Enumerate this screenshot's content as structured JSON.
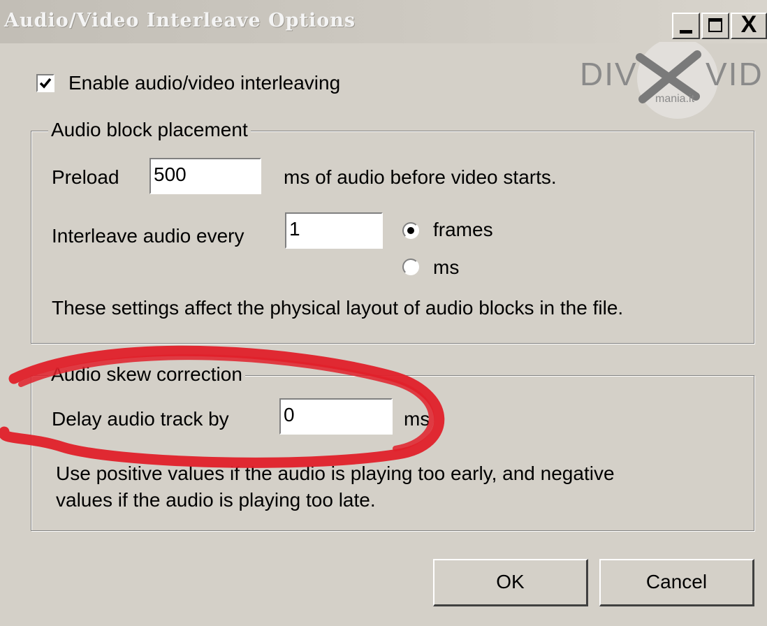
{
  "window": {
    "title": "Audio/Video Interleave Options",
    "close_glyph": "X"
  },
  "logo": {
    "text_main_left": "DIV",
    "text_main_right": "VID",
    "text_sub": "mania.it"
  },
  "enable_interleave": {
    "label": "Enable audio/video interleaving",
    "checked": true
  },
  "audio_block_placement": {
    "title": "Audio block placement",
    "preload_label": "Preload",
    "preload_value": "500",
    "preload_suffix": "ms of audio before video starts.",
    "interleave_label": "Interleave audio every",
    "interleave_value": "1",
    "unit_options": [
      "frames",
      "ms"
    ],
    "selected_unit": "frames",
    "note": "These settings affect the physical layout of audio blocks in the file."
  },
  "audio_skew_correction": {
    "title": "Audio skew correction",
    "delay_label": "Delay audio track by",
    "delay_value": "0",
    "delay_unit": "ms",
    "help_line1": "Use positive values if the audio is playing too early, and negative",
    "help_line2": "values if the audio is playing too late."
  },
  "buttons": {
    "ok": "OK",
    "cancel": "Cancel"
  },
  "colors": {
    "annotation": "#e0202a",
    "dialog_bg": "#d4d0c8"
  }
}
